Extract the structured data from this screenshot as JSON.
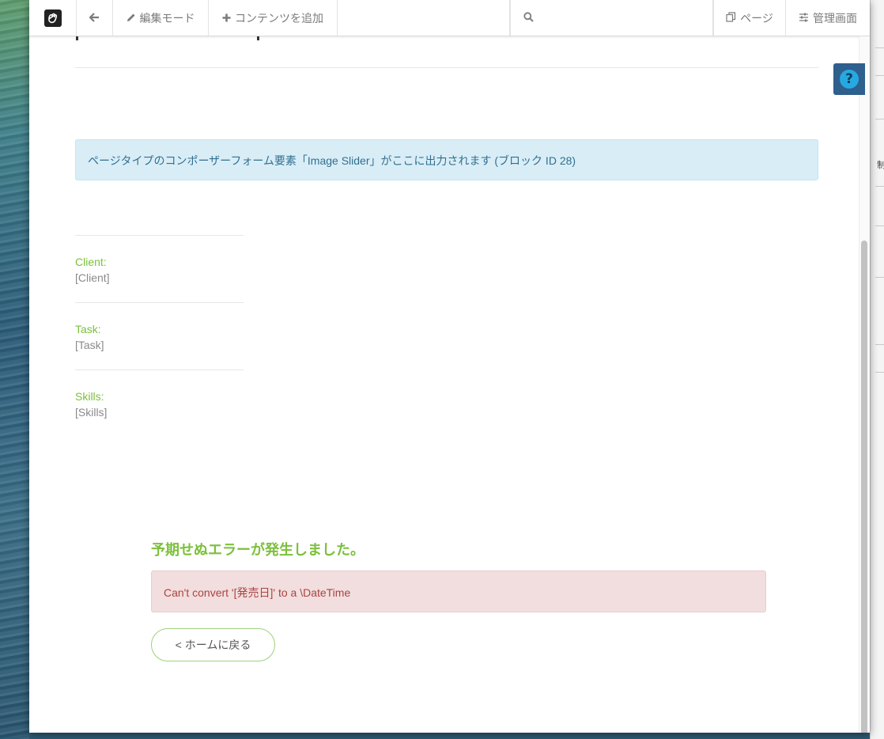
{
  "toolbar": {
    "edit_mode": "編集モード",
    "add_content": "コンテンツを追加",
    "page": "ページ",
    "dashboard": "管理画面"
  },
  "main": {
    "composer_notice": "ページタイプのコンポーザーフォーム要素「Image Slider」がここに出力されます (ブロック ID 28)",
    "meta": [
      {
        "label": "Client:",
        "value": "[Client]"
      },
      {
        "label": "Task:",
        "value": "[Task]"
      },
      {
        "label": "Skills:",
        "value": "[Skills]"
      }
    ]
  },
  "error": {
    "title": "予期せぬエラーが発生しました。",
    "message": "Can't convert '[発売日]' to a \\DateTime",
    "back_button": "< ホームに戻る"
  },
  "help": {
    "glyph": "?"
  },
  "behind_window": {
    "glyph": "制"
  },
  "colors": {
    "accent_green": "#7cc03b",
    "info_bg": "#d9edf7",
    "danger_bg": "#f2dede",
    "help_bg": "#2e5f8d"
  }
}
